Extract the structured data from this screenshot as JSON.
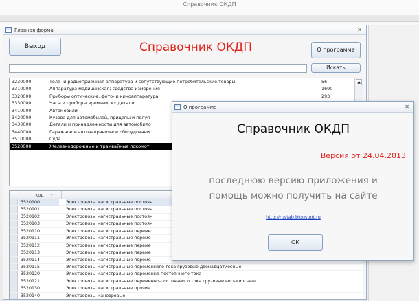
{
  "app": {
    "title": "Справочник ОКДП"
  },
  "main_form": {
    "title": "Главная форма",
    "close_glyph": "✕",
    "exit_label": "Выход",
    "heading": "Справочник ОКДП",
    "about_label": "О программе",
    "search_value": "",
    "search_label": "Искать",
    "upper_list": [
      {
        "code": "3230000",
        "name": "Теле- и радиоприемная аппаратура и сопутствующие потребительские товары",
        "count": "56"
      },
      {
        "code": "3310000",
        "name": "Аппаратура медицинская; средства измерения",
        "count": "1690"
      },
      {
        "code": "3320000",
        "name": "Приборы оптические, фото- и киноаппаратура",
        "count": "293"
      },
      {
        "code": "3330000",
        "name": "Часы и приборы времени, их детали",
        "count": ""
      },
      {
        "code": "3410000",
        "name": "Автомобили",
        "count": ""
      },
      {
        "code": "3420000",
        "name": "Кузова для автомобилей, прицепы и полуп",
        "count": ""
      },
      {
        "code": "3430000",
        "name": "Детали и принадлежности для автомобило",
        "count": ""
      },
      {
        "code": "3440000",
        "name": "Гаражное и автозаправочное оборудовани",
        "count": ""
      },
      {
        "code": "3510000",
        "name": "Суда",
        "count": ""
      },
      {
        "code": "3520000",
        "name": "Железнодорожные и трамвайные локомот",
        "count": ""
      }
    ],
    "upper_scroll_glyph": "▲",
    "grid_header": {
      "code": "код",
      "sort_glyph": "▾"
    },
    "grid_rows": [
      {
        "code": "3520100",
        "name": "Электровозы магистральные постоян"
      },
      {
        "code": "3520101",
        "name": "Электровозы магистральные постоян"
      },
      {
        "code": "3520102",
        "name": "Электровозы магистральные постоян"
      },
      {
        "code": "3520103",
        "name": "Электровозы магистральные постоян"
      },
      {
        "code": "3520110",
        "name": "Электровозы магистральные переме"
      },
      {
        "code": "3520111",
        "name": "Электровозы магистральные переме"
      },
      {
        "code": "3520112",
        "name": "Электровозы магистральные переме"
      },
      {
        "code": "3520113",
        "name": "Электровозы магистральные переме"
      },
      {
        "code": "3520114",
        "name": "Электровозы магистральные переме"
      },
      {
        "code": "3520115",
        "name": "Электровозы магистральные переменного тока грузовые двенадцатиосные"
      },
      {
        "code": "3520120",
        "name": "Электровозы магистральные переменно-постоянного тока"
      },
      {
        "code": "3520121",
        "name": "Электровозы магистральные переменно-постоянного тока грузовые восьмиосные"
      },
      {
        "code": "3520130",
        "name": "Электровозы магистральные прочие"
      },
      {
        "code": "3520140",
        "name": "Электровозы маневровые"
      }
    ]
  },
  "about_dialog": {
    "title": "О программе",
    "close_glyph": "✕",
    "heading": "Справочник ОКДП",
    "version": "Версия от 24.04.2013",
    "text_line1": "последнюю версию приложения и",
    "text_line2": "помощь можно получить на сайте",
    "link": "http://rustab.blogspot.ru",
    "ok_label": "ОК"
  },
  "colors": {
    "accent_red": "#e0231d",
    "link_blue": "#1a3fbf",
    "selected_row_bg": "#000000"
  },
  "icons": {
    "form_icon": "form-icon"
  }
}
